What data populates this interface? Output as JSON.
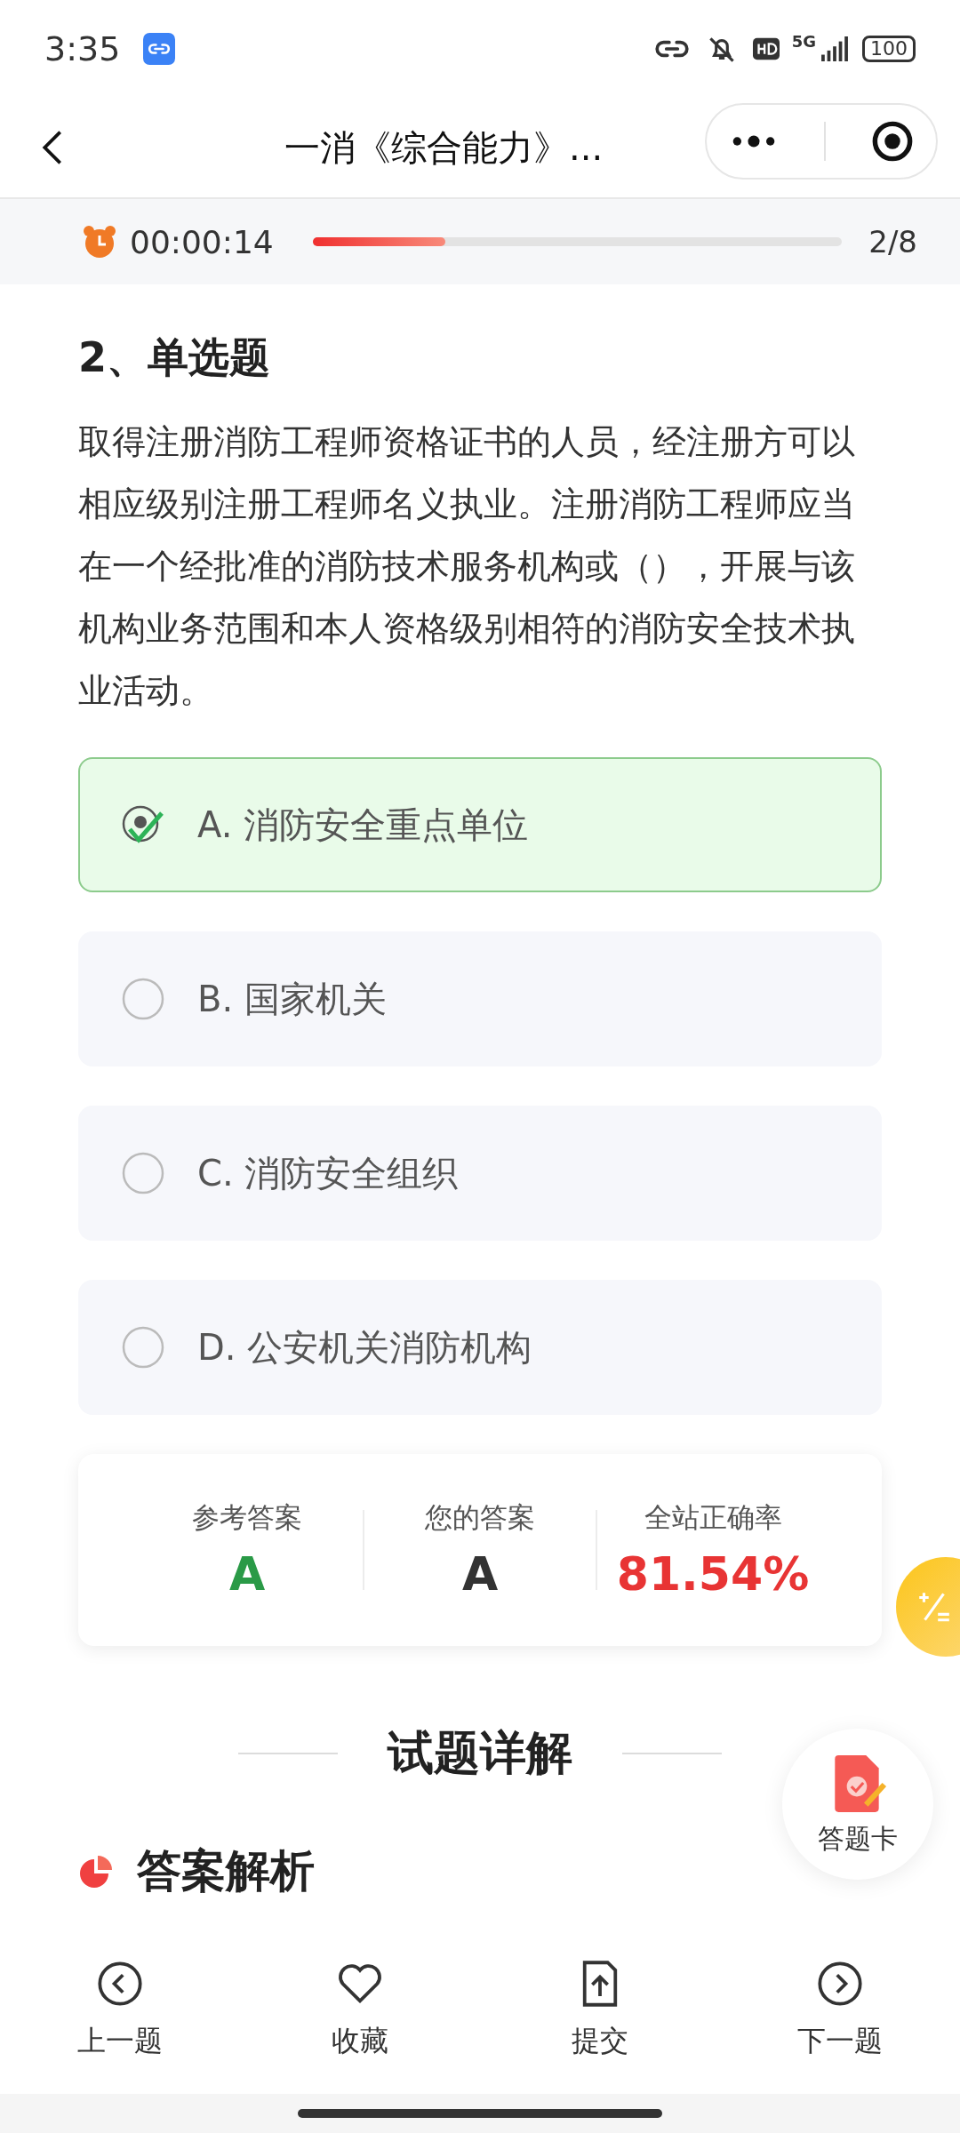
{
  "status_bar": {
    "time": "3:35",
    "network": "5G",
    "battery": "100"
  },
  "nav": {
    "title": "一消《综合能力》..."
  },
  "timer": {
    "time": "00:00:14",
    "level": 0.25,
    "counter": "2/8"
  },
  "question": {
    "heading": "2、单选题",
    "text": "取得注册消防工程师资格证书的人员，经注册方可以相应级别注册工程师名义执业。注册消防工程师应当在一个经批准的消防技术服务机构或（），开展与该机构业务范围和本人资格级别相符的消防安全技术执业活动。",
    "options": [
      {
        "label": "A. 消防安全重点单位",
        "selected": true
      },
      {
        "label": "B. 国家机关",
        "selected": false
      },
      {
        "label": "C. 消防安全组织",
        "selected": false
      },
      {
        "label": "D. 公安机关消防机构",
        "selected": false
      }
    ]
  },
  "stats": [
    {
      "label": "参考答案",
      "value": "A",
      "kind": "correct"
    },
    {
      "label": "您的答案",
      "value": "A",
      "kind": "plain"
    },
    {
      "label": "全站正确率",
      "value": "81.54%",
      "kind": "rate"
    }
  ],
  "detail_heading": "试题详解",
  "answer_card": {
    "label": "答题卡"
  },
  "analysis_heading": "答案解析",
  "bottom_nav": [
    {
      "label": "上一题",
      "kind": "prev"
    },
    {
      "label": "收藏",
      "kind": "favorite"
    },
    {
      "label": "提交",
      "kind": "submit"
    },
    {
      "label": "下一题",
      "kind": "next"
    }
  ]
}
